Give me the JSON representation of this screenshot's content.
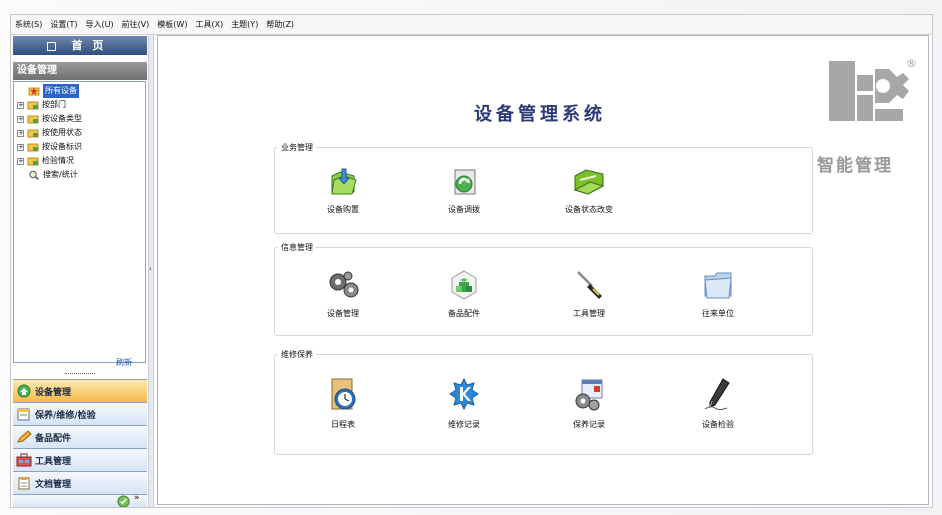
{
  "menubar": {
    "items": [
      "系统(S)",
      "设置(T)",
      "导入(U)",
      "前往(V)",
      "模板(W)",
      "工具(X)",
      "主题(Y)",
      "帮助(Z)"
    ]
  },
  "left": {
    "home_label": "首页",
    "section_title": "设备管理",
    "tree": [
      {
        "label": "所有设备",
        "selected": true
      },
      {
        "label": "按部门"
      },
      {
        "label": "按设备类型"
      },
      {
        "label": "按使用状态"
      },
      {
        "label": "按设备标识"
      },
      {
        "label": "检验情况"
      },
      {
        "label": "搜索/统计"
      }
    ],
    "refresh_label": "刷新",
    "bottom_nav": [
      {
        "label": "设备管理",
        "active": true
      },
      {
        "label": "保养/维修/检验"
      },
      {
        "label": "备品配件"
      },
      {
        "label": "工具管理"
      },
      {
        "label": "文档管理"
      }
    ]
  },
  "main": {
    "system_title": "设备管理系统",
    "groups": [
      {
        "label": "业务管理",
        "items": [
          "设备购置",
          "设备调拨",
          "设备状态改变"
        ]
      },
      {
        "label": "信息管理",
        "items": [
          "设备管理",
          "备品配件",
          "工具管理",
          "往来单位"
        ]
      },
      {
        "label": "维修保养",
        "items": [
          "日程表",
          "维修记录",
          "保养记录",
          "设备检验"
        ]
      }
    ],
    "brand": {
      "name": "智能管理",
      "reg": "®"
    }
  },
  "colors": {
    "accent": "#2f64c7",
    "title": "#2c3a78",
    "brand": "#9a9a9a",
    "nav_active": "#f4b84a"
  }
}
